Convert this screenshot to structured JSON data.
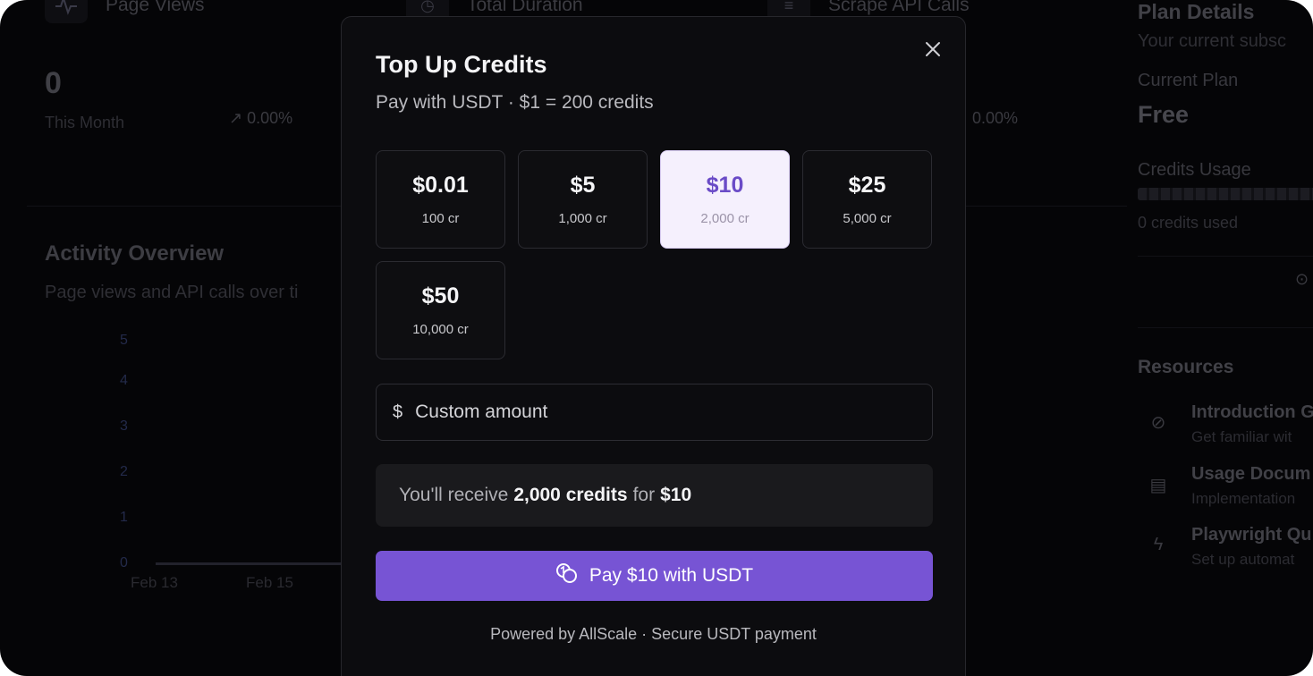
{
  "background": {
    "stats": [
      {
        "label": "Page Views",
        "icon": "activity-icon",
        "value": "0",
        "period": "This Month",
        "change": "0.00%"
      },
      {
        "label": "Total Duration",
        "icon": "clock-icon"
      },
      {
        "label": "Scrape API Calls",
        "icon": "database-icon",
        "change": "0.00%"
      }
    ],
    "activity": {
      "title": "Activity Overview",
      "subtitle": "Page views and API calls over ti",
      "y_ticks": [
        "5",
        "4",
        "3",
        "2",
        "1",
        "0"
      ],
      "x_ticks": [
        "Feb 13",
        "Feb 15"
      ]
    },
    "plan": {
      "title": "Plan Details",
      "subtitle": "Your current subsc",
      "current_plan_label": "Current Plan",
      "current_plan_value": "Free",
      "credits_usage_label": "Credits Usage",
      "credits_used": "0 credits used"
    },
    "resources": {
      "title": "Resources",
      "items": [
        {
          "icon": "compass-icon",
          "title": "Introduction G",
          "subtitle": "Get familiar wit"
        },
        {
          "icon": "document-icon",
          "title": "Usage Docum",
          "subtitle": "Implementation"
        },
        {
          "icon": "lightning-icon",
          "title": "Playwright Qu",
          "subtitle": "Set up automat"
        }
      ]
    }
  },
  "modal": {
    "title": "Top Up Credits",
    "subtitle": "Pay with USDT · $1 = 200 credits",
    "options": [
      {
        "price": "$0.01",
        "credits": "100 cr",
        "selected": false
      },
      {
        "price": "$5",
        "credits": "1,000 cr",
        "selected": false
      },
      {
        "price": "$10",
        "credits": "2,000 cr",
        "selected": true
      },
      {
        "price": "$25",
        "credits": "5,000 cr",
        "selected": false
      },
      {
        "price": "$50",
        "credits": "10,000 cr",
        "selected": false
      }
    ],
    "custom_amount": {
      "currency_symbol": "$",
      "placeholder": "Custom amount",
      "value": ""
    },
    "summary": {
      "prefix": "You'll receive",
      "credits": "2,000 credits",
      "middle": "for",
      "amount": "$10"
    },
    "pay_button": {
      "icon": "coins-icon",
      "label": "Pay $10 with USDT"
    },
    "footer": "Powered by AllScale · Secure USDT payment",
    "close_icon": "close-icon"
  },
  "colors": {
    "accent": "#7754d4",
    "selected_bg": "#f5f0fd",
    "selected_text": "#6a4bc7",
    "modal_bg": "#0c0c0f",
    "backdrop": "#050507"
  }
}
